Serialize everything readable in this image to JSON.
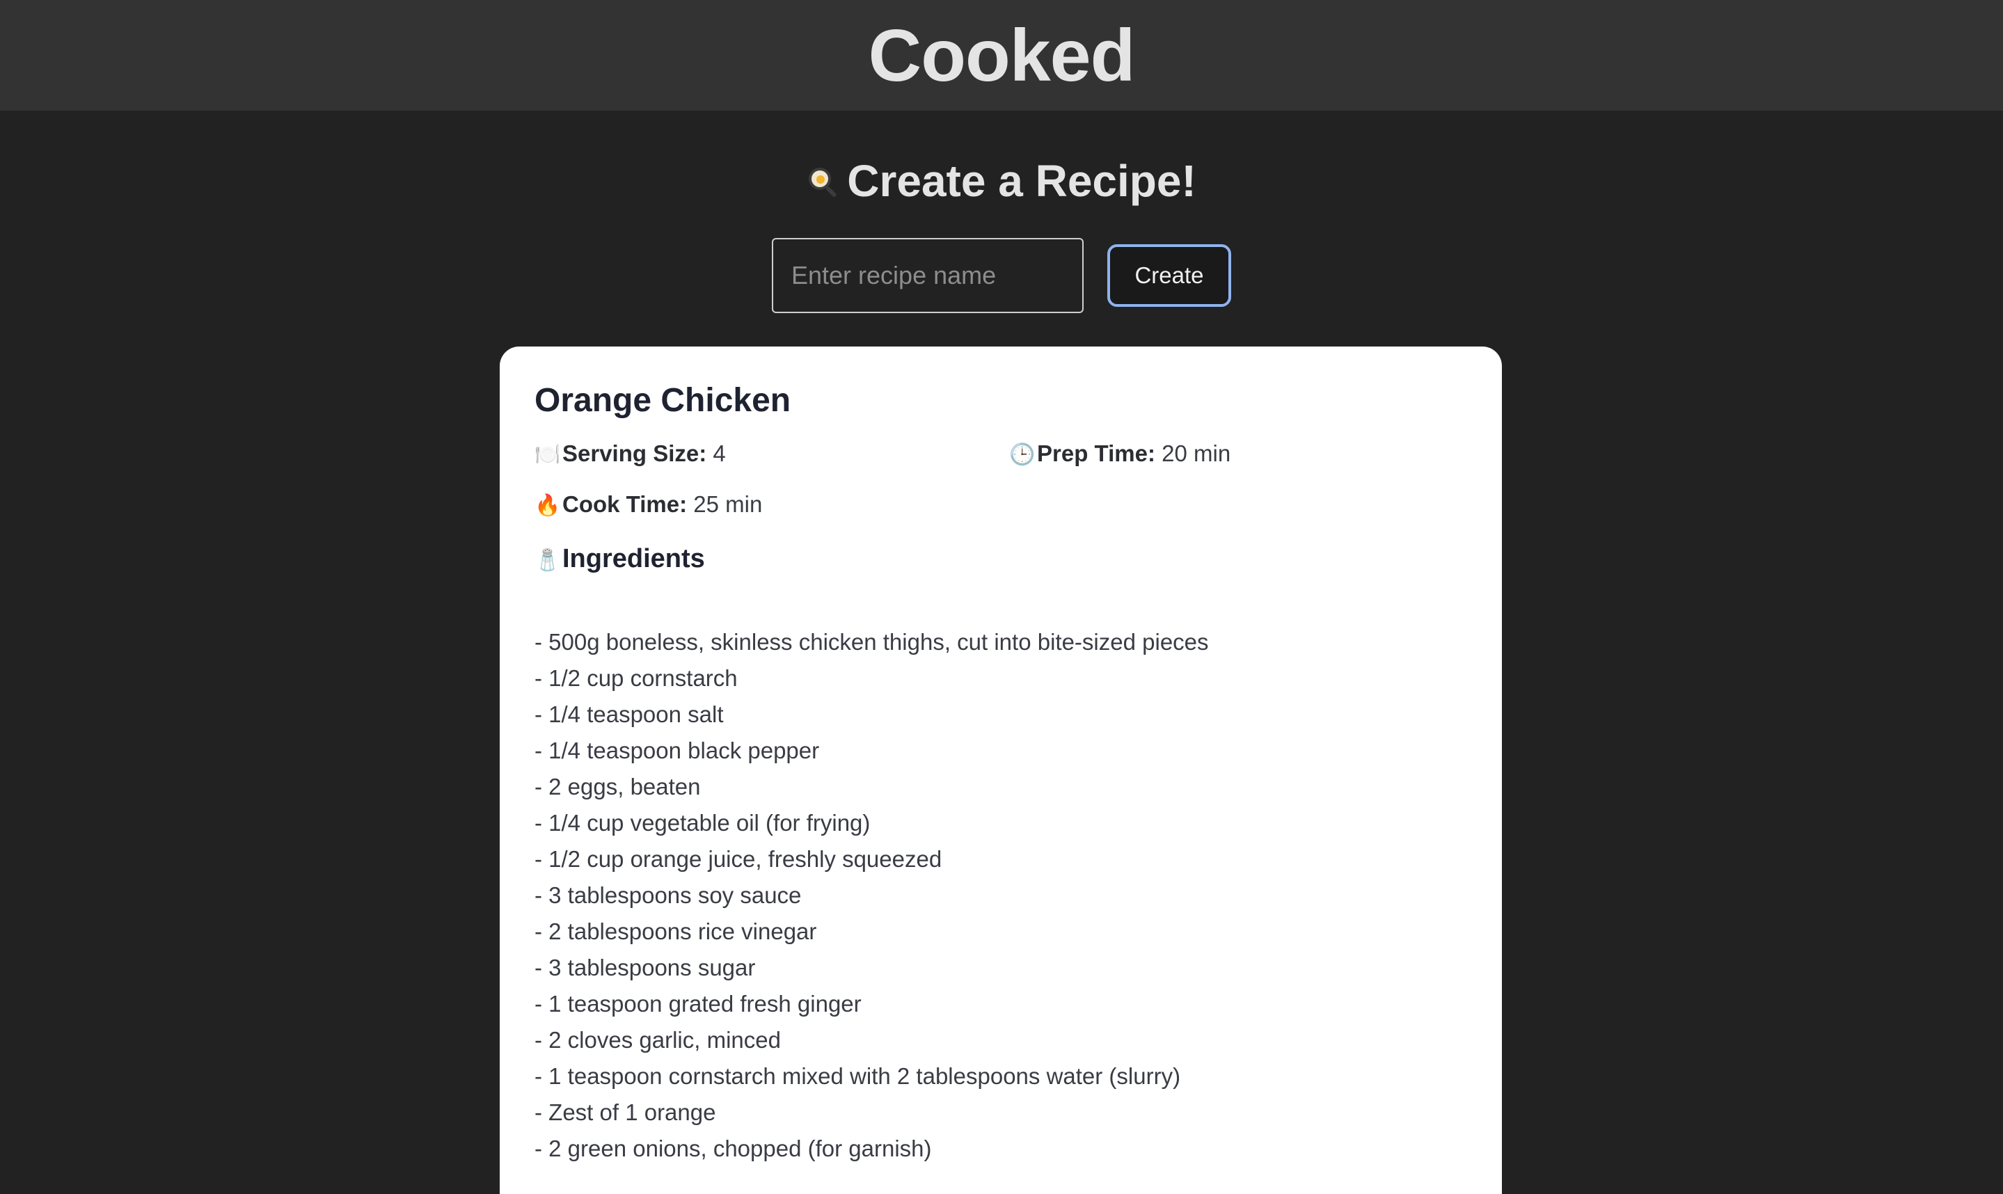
{
  "app": {
    "title": "Cooked"
  },
  "create": {
    "heading_icon": "frying-pan-icon",
    "heading": "Create a Recipe!",
    "input_placeholder": "Enter recipe name",
    "input_value": "",
    "button_label": "Create",
    "button_border_color": "#8fb3ee"
  },
  "recipe": {
    "title": "Orange Chicken",
    "serving": {
      "icon": "🍽️",
      "label": "Serving Size:",
      "value": "4"
    },
    "prep": {
      "icon": "🕒",
      "label": "Prep Time:",
      "value": "20 min"
    },
    "cook": {
      "icon": "🔥",
      "label": "Cook Time:",
      "value": "25 min"
    },
    "ingredients_icon": "🧂",
    "ingredients_title": "Ingredients",
    "ingredients": [
      "- 500g boneless, skinless chicken thighs, cut into bite-sized pieces",
      "- 1/2 cup cornstarch",
      "- 1/4 teaspoon salt",
      "- 1/4 teaspoon black pepper",
      "- 2 eggs, beaten",
      "- 1/4 cup vegetable oil (for frying)",
      "- 1/2 cup orange juice, freshly squeezed",
      "- 3 tablespoons soy sauce",
      "- 2 tablespoons rice vinegar",
      "- 3 tablespoons sugar",
      "- 1 teaspoon grated fresh ginger",
      "- 2 cloves garlic, minced",
      "- 1 teaspoon cornstarch mixed with 2 tablespoons water (slurry)",
      "- Zest of 1 orange",
      "- 2 green onions, chopped (for garnish)"
    ]
  }
}
